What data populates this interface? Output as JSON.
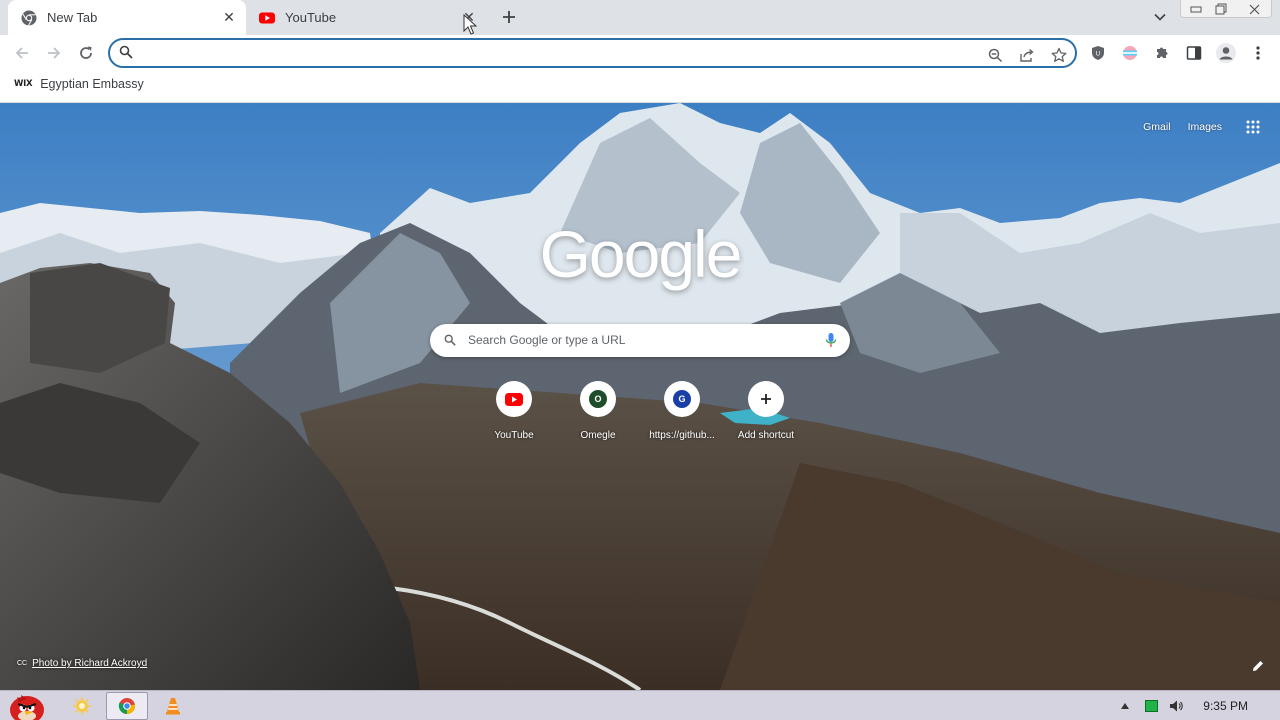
{
  "tabs": [
    {
      "title": "New Tab",
      "icon": "chrome-icon",
      "active": true
    },
    {
      "title": "YouTube",
      "icon": "youtube-icon",
      "active": false
    }
  ],
  "omnibox": {
    "value": "",
    "placeholder": ""
  },
  "bookmarks": [
    {
      "icon_text": "WIX",
      "label": "Egyptian Embassy"
    }
  ],
  "ntp": {
    "links": {
      "gmail": "Gmail",
      "images": "Images"
    },
    "logo": "Google",
    "search_placeholder": "Search Google or type a URL",
    "shortcuts": [
      {
        "label": "YouTube",
        "icon": "youtube-icon",
        "letter": ""
      },
      {
        "label": "Omegle",
        "icon": "letter-icon",
        "letter": "O",
        "color": "#1e4d2b"
      },
      {
        "label": "https://github...",
        "icon": "letter-icon",
        "letter": "G",
        "color": "#1a3fa6"
      },
      {
        "label": "Add shortcut",
        "icon": "plus-icon",
        "letter": ""
      }
    ],
    "credit_badge": "CC",
    "photo_credit": "Photo by Richard Ackroyd"
  },
  "taskbar": {
    "apps": [
      "angry-birds-icon",
      "files-icon",
      "chrome-icon",
      "vlc-icon"
    ],
    "clock": "9:35 PM"
  },
  "colors": {
    "accent": "#2a6fa8",
    "tabstrip": "#dee1e6",
    "youtube_red": "#ff0000",
    "taskbar": "#d6d3e0"
  }
}
